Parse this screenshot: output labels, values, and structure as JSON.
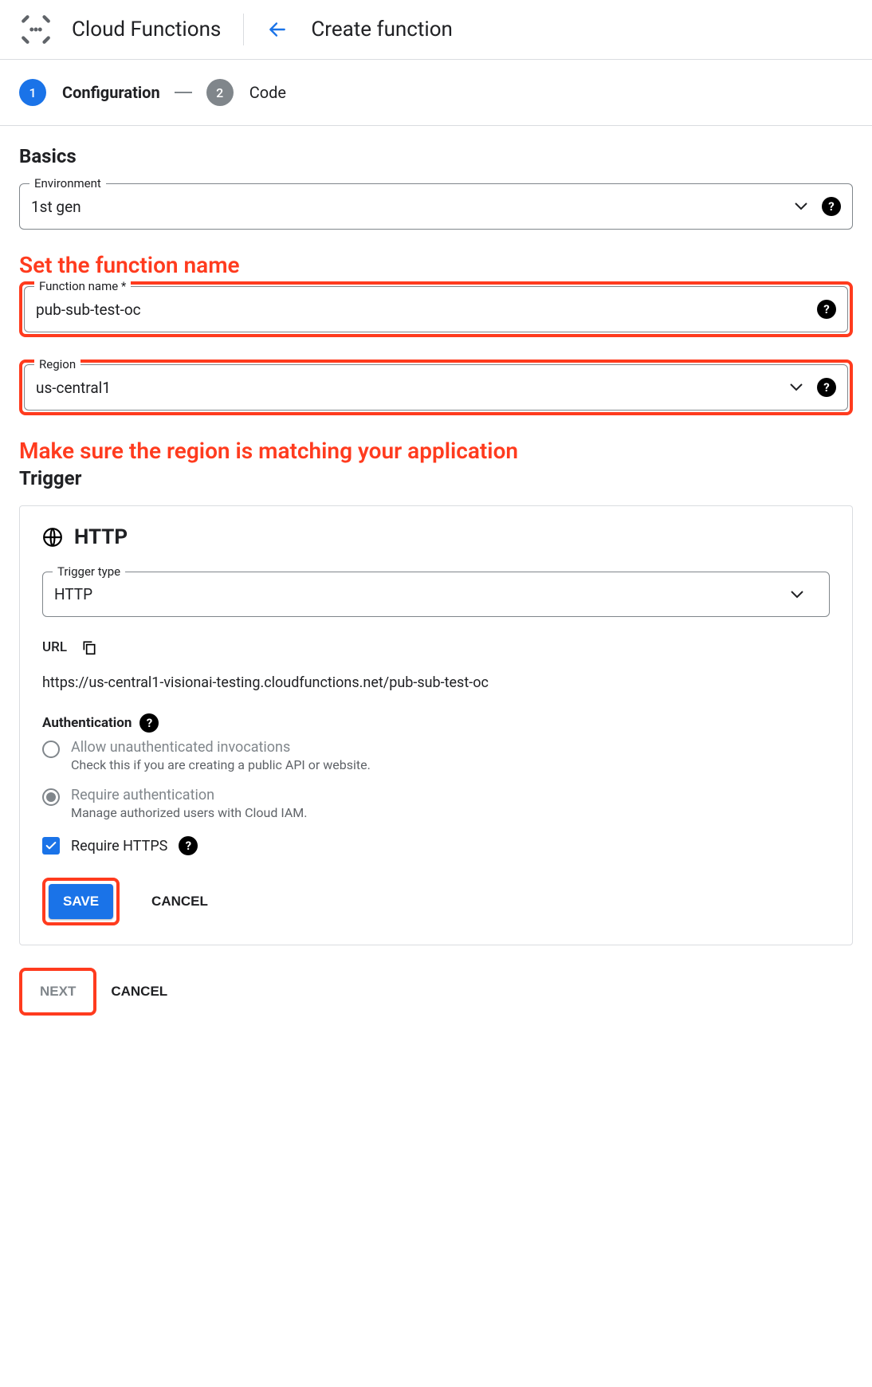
{
  "header": {
    "product_title": "Cloud Functions",
    "page_title": "Create function"
  },
  "stepper": {
    "step1_number": "1",
    "step1_label": "Configuration",
    "step2_number": "2",
    "step2_label": "Code"
  },
  "annotations": {
    "function_name": "Set the function name",
    "region": "Make sure the region is matching your application"
  },
  "basics": {
    "section_title": "Basics",
    "environment": {
      "label": "Environment",
      "value": "1st gen"
    },
    "function_name": {
      "label": "Function name *",
      "value": "pub-sub-test-oc"
    },
    "region": {
      "label": "Region",
      "value": "us-central1"
    }
  },
  "trigger": {
    "section_title": "Trigger",
    "heading": "HTTP",
    "trigger_type": {
      "label": "Trigger type",
      "value": "HTTP"
    },
    "url_label": "URL",
    "url_value": "https://us-central1-visionai-testing.cloudfunctions.net/pub-sub-test-oc",
    "auth_label": "Authentication",
    "auth_options": [
      {
        "label": "Allow unauthenticated invocations",
        "desc": "Check this if you are creating a public API or website.",
        "checked": false
      },
      {
        "label": "Require authentication",
        "desc": "Manage authorized users with Cloud IAM.",
        "checked": true
      }
    ],
    "require_https": {
      "label": "Require HTTPS",
      "checked": true
    },
    "save_label": "SAVE",
    "cancel_label": "CANCEL"
  },
  "footer": {
    "next_label": "NEXT",
    "cancel_label": "CANCEL"
  }
}
